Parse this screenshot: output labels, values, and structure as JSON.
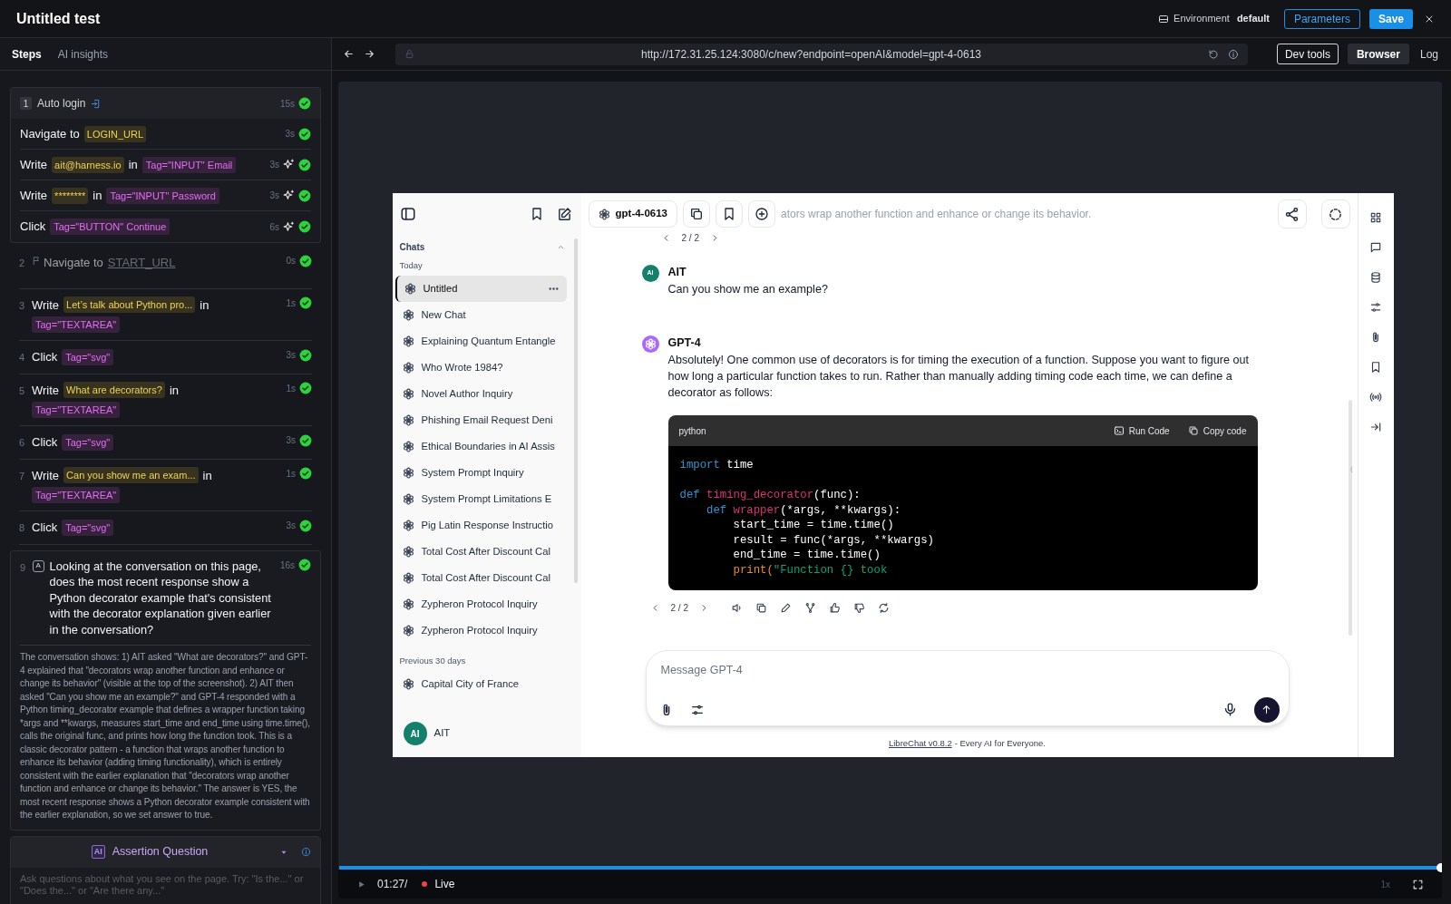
{
  "title": "Untitled test",
  "environment": {
    "label": "Environment",
    "value": "default"
  },
  "header_buttons": [
    {
      "label": "Parameters",
      "kind": "outline"
    },
    {
      "label": "Save",
      "kind": "primary"
    }
  ],
  "left_tabs": [
    {
      "label": "Steps",
      "selected": true
    },
    {
      "label": "AI insights",
      "selected": false
    }
  ],
  "steps": [
    {
      "kind": "group",
      "number": "1",
      "label": "Auto login",
      "duration": "15s",
      "passed": true,
      "children": [
        {
          "segments": [
            {
              "kind": "text",
              "text": "Navigate to"
            },
            {
              "kind": "value",
              "text": "LOGIN_URL"
            }
          ],
          "duration": "3s",
          "passed": true,
          "ai_healed": false
        },
        {
          "segments": [
            {
              "kind": "text",
              "text": "Write"
            },
            {
              "kind": "value",
              "text": "ait@harness.io"
            },
            {
              "kind": "text",
              "text": "in"
            },
            {
              "kind": "tag",
              "text": "Tag=\"INPUT\" Email"
            }
          ],
          "duration": "3s",
          "passed": true,
          "ai_healed": true
        },
        {
          "segments": [
            {
              "kind": "text",
              "text": "Write"
            },
            {
              "kind": "value",
              "text": "********"
            },
            {
              "kind": "text",
              "text": "in"
            },
            {
              "kind": "tag",
              "text": "Tag=\"INPUT\" Password"
            }
          ],
          "duration": "3s",
          "passed": true,
          "ai_healed": true
        },
        {
          "segments": [
            {
              "kind": "text",
              "text": "Click"
            },
            {
              "kind": "tag",
              "text": "Tag=\"BUTTON\" Continue"
            }
          ],
          "duration": "6s",
          "passed": true,
          "ai_healed": true
        }
      ]
    },
    {
      "kind": "navigation",
      "number": "2",
      "segments": [
        {
          "kind": "text",
          "text": "Navigate to"
        },
        {
          "kind": "link",
          "text": "START_URL"
        }
      ],
      "duration": "0s",
      "passed": true
    },
    {
      "kind": "action",
      "number": "3",
      "segments": [
        {
          "kind": "text",
          "text": "Write"
        },
        {
          "kind": "value",
          "text": "Let’s talk about Python pro..."
        },
        {
          "kind": "text",
          "text": "in"
        },
        {
          "kind": "tag",
          "text": "Tag=\"TEXTAREA\""
        }
      ],
      "duration": "1s",
      "passed": true
    },
    {
      "kind": "action",
      "number": "4",
      "segments": [
        {
          "kind": "text",
          "text": "Click"
        },
        {
          "kind": "tag",
          "text": "Tag=\"svg\""
        }
      ],
      "duration": "3s",
      "passed": true
    },
    {
      "kind": "action",
      "number": "5",
      "segments": [
        {
          "kind": "text",
          "text": "Write"
        },
        {
          "kind": "value",
          "text": "What are decorators?"
        },
        {
          "kind": "text",
          "text": "in"
        },
        {
          "kind": "tag",
          "text": "Tag=\"TEXTAREA\""
        }
      ],
      "duration": "1s",
      "passed": true
    },
    {
      "kind": "action",
      "number": "6",
      "segments": [
        {
          "kind": "text",
          "text": "Click"
        },
        {
          "kind": "tag",
          "text": "Tag=\"svg\""
        }
      ],
      "duration": "3s",
      "passed": true
    },
    {
      "kind": "action",
      "number": "7",
      "segments": [
        {
          "kind": "text",
          "text": "Write"
        },
        {
          "kind": "value",
          "text": "Can you show me an exam..."
        },
        {
          "kind": "text",
          "text": "in"
        },
        {
          "kind": "tag",
          "text": "Tag=\"TEXTAREA\""
        }
      ],
      "duration": "1s",
      "passed": true
    },
    {
      "kind": "action",
      "number": "8",
      "segments": [
        {
          "kind": "text",
          "text": "Click"
        },
        {
          "kind": "tag",
          "text": "Tag=\"svg\""
        }
      ],
      "duration": "3s",
      "passed": true
    },
    {
      "kind": "assertion",
      "number": "9",
      "badge": "A",
      "question": "Looking at the conversation on this page, does the most recent response show a Python decorator example that's consistent with the decorator explanation given earlier in the conversation?",
      "duration": "16s",
      "passed": true,
      "explanation": "The conversation shows: 1) AIT asked \"What are decorators?\" and GPT-4 explained that \"decorators wrap another function and enhance or change its behavior\" (visible at the top of the screenshot). 2) AIT then asked \"Can you show me an example?\" and GPT-4 responded with a Python timing_decorator example that defines a wrapper function taking *args and **kwargs, measures start_time and end_time using time.time(), calls the original func, and prints how long the function took. This is a classic decorator pattern - a function that wraps another function to enhance its behavior (adding timing functionality), which is entirely consistent with the earlier explanation that \"decorators wrap another function and enhance or change its behavior.\" The answer is YES, the most recent response shows a Python decorator example consistent with the earlier explanation, so we set answer to true."
    }
  ],
  "assertion_panel": {
    "badge": "AI",
    "title": "Assertion Question",
    "placeholder": "Ask questions about what you see on the page. Try: \"Is the...\" or \"Does the...\" or \"Are there any...\""
  },
  "browser": {
    "url": "http://172.31.25.124:3080/c/new?endpoint=openAI&model=gpt-4-0613",
    "dev_tools": "Dev tools",
    "view_tabs": [
      {
        "label": "Browser",
        "selected": true
      },
      {
        "label": "Log",
        "selected": false
      }
    ]
  },
  "page": {
    "sidebar": {
      "section": "Chats",
      "groups": [
        {
          "label": "Today",
          "items": [
            {
              "title": "Untitled",
              "selected": true
            },
            {
              "title": "New Chat",
              "selected": false
            },
            {
              "title": "Explaining Quantum Entangle",
              "selected": false
            },
            {
              "title": "Who Wrote 1984?",
              "selected": false
            },
            {
              "title": "Novel Author Inquiry",
              "selected": false
            },
            {
              "title": "Phishing Email Request Deni",
              "selected": false
            },
            {
              "title": "Ethical Boundaries in AI Assis",
              "selected": false
            },
            {
              "title": "System Prompt Inquiry",
              "selected": false
            },
            {
              "title": "System Prompt Limitations E",
              "selected": false
            },
            {
              "title": "Pig Latin Response Instructio",
              "selected": false
            },
            {
              "title": "Total Cost After Discount Cal",
              "selected": false
            },
            {
              "title": "Total Cost After Discount Cal",
              "selected": false
            },
            {
              "title": "Zypheron Protocol Inquiry",
              "selected": false
            },
            {
              "title": "Zypheron Protocol Inquiry",
              "selected": false
            }
          ]
        },
        {
          "label": "Previous 30 days",
          "items": [
            {
              "title": "Capital City of France",
              "selected": false
            }
          ]
        }
      ],
      "user": {
        "initials": "AI",
        "name": "AIT"
      }
    },
    "model": "gpt-4-0613",
    "faded_text": "ators wrap another function and enhance or change its behavior.",
    "pager_top": "2 / 2",
    "messages": [
      {
        "kind": "user",
        "avatar": "AI",
        "author": "AIT",
        "text": "Can you show me an example?"
      },
      {
        "kind": "assistant",
        "author": "GPT-4",
        "text": "Absolutely! One common use of decorators is for timing the execution of a function. Suppose you want to figure out how long a particular function takes to run. Rather than manually adding timing code each time, we can define a decorator as follows:",
        "pager": "2 / 2",
        "code": {
          "language": "python",
          "run_label": "Run Code",
          "copy_label": "Copy code",
          "lines": [
            {
              "blank_before": false,
              "tokens": [
                {
                  "text": "import",
                  "kind": "keyword"
                },
                {
                  "text": " time",
                  "kind": "plain"
                }
              ]
            },
            {
              "blank_before": true,
              "tokens": [
                {
                  "text": "def",
                  "kind": "keyword"
                },
                {
                  "text": " timing_decorator",
                  "kind": "function"
                },
                {
                  "text": "(func):",
                  "kind": "plain"
                }
              ]
            },
            {
              "blank_before": false,
              "tokens": [
                {
                  "text": "    def",
                  "kind": "keyword"
                },
                {
                  "text": " wrapper",
                  "kind": "function"
                },
                {
                  "text": "(*args, **kwargs):",
                  "kind": "plain"
                }
              ]
            },
            {
              "blank_before": false,
              "tokens": [
                {
                  "text": "        start_time = time.time()",
                  "kind": "plain"
                }
              ]
            },
            {
              "blank_before": false,
              "tokens": [
                {
                  "text": "        result = func(*args, **kwargs)",
                  "kind": "plain"
                }
              ]
            },
            {
              "blank_before": false,
              "tokens": [
                {
                  "text": "        end_time = time.time()",
                  "kind": "plain"
                }
              ]
            },
            {
              "blank_before": false,
              "tokens": [
                {
                  "text": "        print(",
                  "kind": "builtin"
                },
                {
                  "text": "\"Function {} took",
                  "kind": "string"
                }
              ]
            }
          ]
        }
      }
    ],
    "composer": {
      "placeholder": "Message GPT-4"
    },
    "footer": {
      "link": "LibreChat v0.8.2",
      "text": "- Every AI for Everyone."
    }
  },
  "player": {
    "level": 1,
    "time": "01:27/",
    "live": "Live",
    "speed": "1x"
  }
}
